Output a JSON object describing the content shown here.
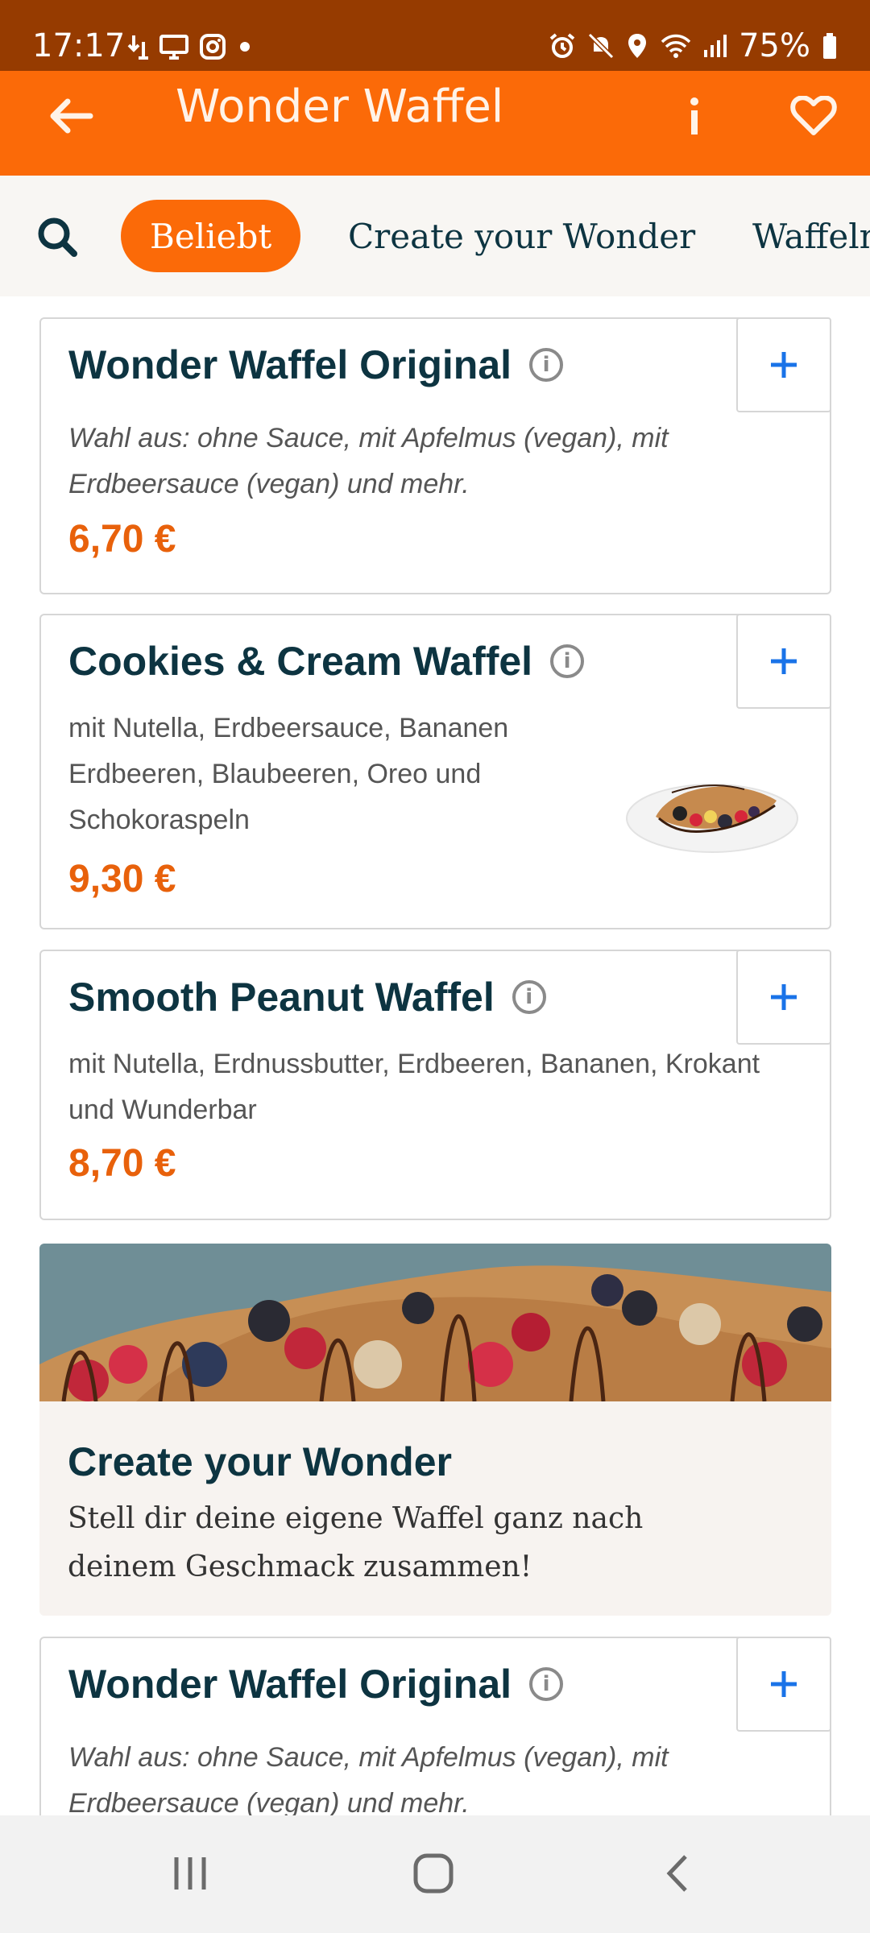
{
  "status_bar": {
    "time": "17:17",
    "battery": "75%",
    "left_icons": [
      "download-arrow-icon",
      "screen-cast-icon",
      "instagram-icon",
      "dot-icon"
    ],
    "right_icons": [
      "alarm-icon",
      "mute-icon",
      "location-icon",
      "wifi-icon",
      "signal-icon",
      "battery-icon"
    ]
  },
  "app_bar": {
    "title": "Wonder Waffel",
    "back_icon": "back-arrow-icon",
    "info_icon": "info-icon",
    "favorite_icon": "heart-icon"
  },
  "categories": {
    "search_icon": "search-icon",
    "tabs": [
      {
        "label": "Beliebt",
        "active": true
      },
      {
        "label": "Create your Wonder",
        "active": false
      },
      {
        "label": "Waffeln",
        "active": false
      }
    ]
  },
  "products": [
    {
      "name": "Wonder Waffel Original",
      "description": "Wahl aus: ohne Sauce, mit Apfelmus (vegan), mit Erdbeersauce (vegan) und mehr.",
      "price": "6,70 €",
      "add_label": "+"
    },
    {
      "name": "Cookies & Cream Waffel",
      "description": "mit Nutella, Erdbeersauce, Bananen Erdbeeren, Blaubeeren, Oreo und Schokoraspeln",
      "price": "9,30 €",
      "add_label": "+",
      "has_image": true
    },
    {
      "name": "Smooth Peanut Waffel",
      "description": "mit Nutella, Erdnussbutter, Erdbeeren, Bananen, Krokant und Wunderbar",
      "price": "8,70 €",
      "add_label": "+"
    },
    {
      "name": "Wonder Waffel Original",
      "description": "Wahl aus: ohne Sauce, mit Apfelmus (vegan), mit Erdbeersauce (vegan) und mehr.",
      "add_label": "+"
    }
  ],
  "promo": {
    "title": "Create your Wonder",
    "text": "Stell dir deine eigene Waffel ganz nach deinem Geschmack zusammen!"
  },
  "colors": {
    "status_bar": "#963b00",
    "app_bar": "#fb6a08",
    "accent_price": "#e8610b",
    "add_icon": "#1a73e8",
    "title_text": "#0d3441"
  },
  "nav_bar": {
    "icons": [
      "recent-apps-icon",
      "home-icon",
      "back-icon"
    ]
  }
}
